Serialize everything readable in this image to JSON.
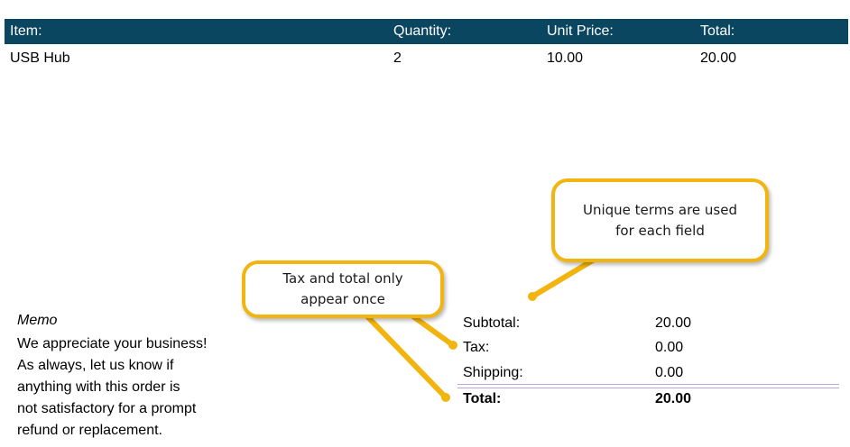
{
  "table": {
    "headers": {
      "item": "Item:",
      "quantity": "Quantity:",
      "unit_price": "Unit Price:",
      "total": "Total:"
    },
    "rows": [
      {
        "item": "USB Hub",
        "quantity": "2",
        "unit_price": "10.00",
        "total": "20.00"
      }
    ]
  },
  "memo": {
    "title": "Memo",
    "lines": [
      "We appreciate your business!",
      "As always, let us know if",
      "anything with this order is",
      "not satisfactory for a prompt",
      "refund or replacement."
    ]
  },
  "summary": {
    "subtotal": {
      "label": "Subtotal:",
      "value": "20.00"
    },
    "tax": {
      "label": "Tax:",
      "value": "0.00"
    },
    "shipping": {
      "label": "Shipping:",
      "value": "0.00"
    },
    "total": {
      "label": "Total:",
      "value": "20.00"
    }
  },
  "callouts": {
    "tax_total": "Tax and total only\nappear once",
    "unique_terms": "Unique terms are used\nfor each field"
  },
  "colors": {
    "header_bg": "#0b4660",
    "callout_border": "#f2b50f",
    "total_rule": "#b9a6d6"
  }
}
